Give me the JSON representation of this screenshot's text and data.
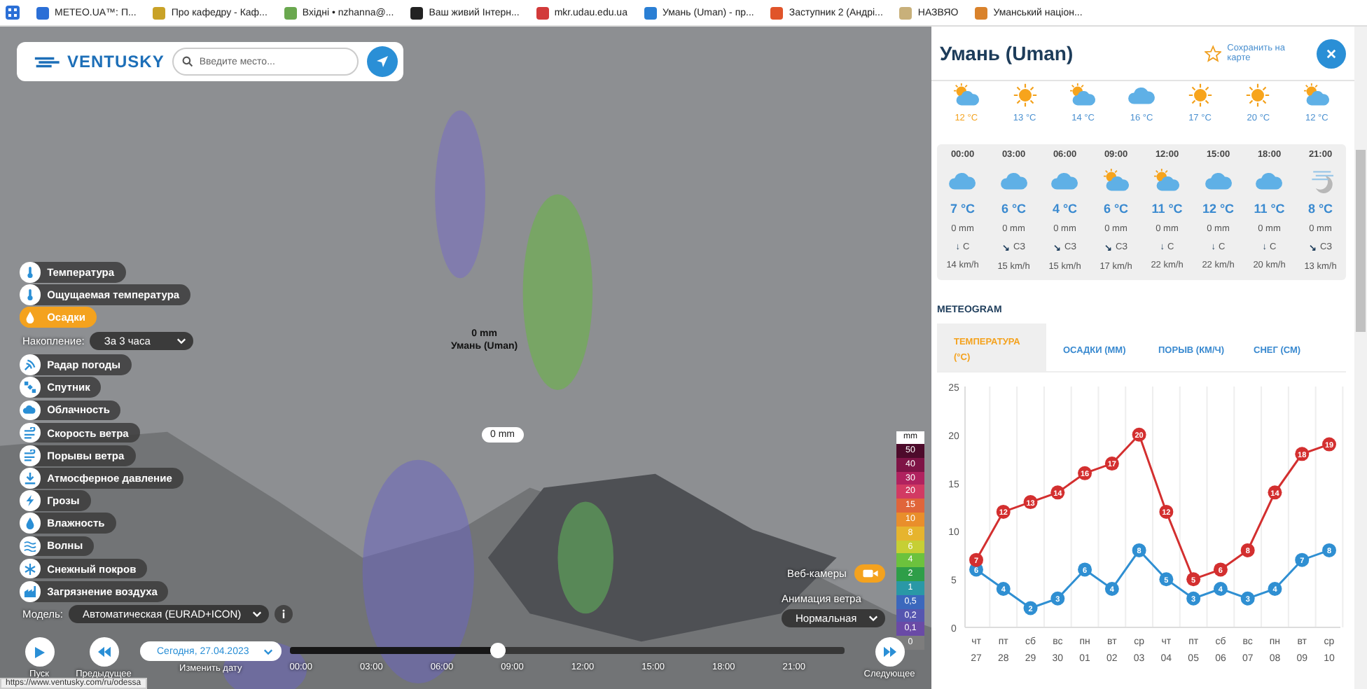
{
  "bookmarks": [
    {
      "label": "METEO.UA™: П...",
      "color": "#2b6fd6"
    },
    {
      "label": "Про кафедру - Каф...",
      "color": "#c9a227"
    },
    {
      "label": "Вхідні • nzhanna@...",
      "color": "#6aa84f"
    },
    {
      "label": "Ваш живий Інтерн...",
      "color": "#222222"
    },
    {
      "label": "mkr.udau.edu.ua",
      "color": "#d23a3a"
    },
    {
      "label": "Умань (Uman) - пр...",
      "color": "#2a7fd4"
    },
    {
      "label": "Заступник 2 (Андрі...",
      "color": "#e0542a"
    },
    {
      "label": "НАЗВЯО",
      "color": "#c8b07a"
    },
    {
      "label": "Уманський націон...",
      "color": "#d9822b"
    }
  ],
  "header": {
    "logo": "VENTUSKY",
    "search": {
      "placeholder": "Введите место..."
    }
  },
  "markers": [
    {
      "kind": "label",
      "reading": "0 mm",
      "place": "Умань (Uman)"
    },
    {
      "kind": "bubble",
      "reading": "0 mm"
    }
  ],
  "layers": [
    {
      "label": "Температура",
      "kind": "thermometer",
      "selected": false
    },
    {
      "label": "Ощущаемая температура",
      "kind": "thermometer",
      "selected": false
    },
    {
      "label": "Осадки",
      "kind": "droplet",
      "selected": true
    },
    {
      "label": "Радар погоды",
      "kind": "radar",
      "selected": false
    },
    {
      "label": "Спутник",
      "kind": "satellite",
      "selected": false
    },
    {
      "label": "Облачность",
      "kind": "cloud",
      "selected": false
    },
    {
      "label": "Скорость ветра",
      "kind": "wind",
      "selected": false
    },
    {
      "label": "Порывы ветра",
      "kind": "wind",
      "selected": false
    },
    {
      "label": "Атмосферное давление",
      "kind": "pressure",
      "selected": false
    },
    {
      "label": "Грозы",
      "kind": "bolt",
      "selected": false
    },
    {
      "label": "Влажность",
      "kind": "droplet",
      "selected": false
    },
    {
      "label": "Волны",
      "kind": "waves",
      "selected": false
    },
    {
      "label": "Снежный покров",
      "kind": "snowflake",
      "selected": false
    },
    {
      "label": "Загрязнение воздуха",
      "kind": "factory",
      "selected": false
    }
  ],
  "accumulation": {
    "label": "Накопление:",
    "value": "За 3 часа"
  },
  "model": {
    "label": "Модель:",
    "value": "Автоматическая (EURAD+ICON)"
  },
  "legend": {
    "unit": "mm",
    "steps": [
      {
        "label": "50",
        "color": "#4d0b2b"
      },
      {
        "label": "40",
        "color": "#7e1446"
      },
      {
        "label": "30",
        "color": "#b0225f"
      },
      {
        "label": "20",
        "color": "#d23a63"
      },
      {
        "label": "15",
        "color": "#e0653a"
      },
      {
        "label": "10",
        "color": "#e98e2b"
      },
      {
        "label": "8",
        "color": "#e6b42e"
      },
      {
        "label": "6",
        "color": "#c6cf34"
      },
      {
        "label": "4",
        "color": "#6cc23d"
      },
      {
        "label": "2",
        "color": "#2e9e48"
      },
      {
        "label": "1",
        "color": "#2a98a6"
      },
      {
        "label": "0,5",
        "color": "#3b68bd"
      },
      {
        "label": "0,2",
        "color": "#5656b0"
      },
      {
        "label": "0,1",
        "color": "#6a4aa6"
      },
      {
        "label": "0",
        "color": "#7d7d7d"
      }
    ]
  },
  "webcams": {
    "label": "Веб-камеры",
    "on": true
  },
  "wind_animation": {
    "label": "Анимация ветра",
    "value": "Нормальная"
  },
  "timeline": {
    "play": "Пуск",
    "previous": "Предыдущее",
    "date": "Сегодня, 27.04.2023",
    "change_date": "Изменить дату",
    "next": "Следующее",
    "times": [
      "00:00",
      "03:00",
      "06:00",
      "09:00",
      "12:00",
      "15:00",
      "18:00",
      "21:00"
    ],
    "level": 0.375
  },
  "status_url": "https://www.ventusky.com/ru/odessa",
  "panel": {
    "title": "Умань (Uman)",
    "save": "Сохранить на карте",
    "top_row": [
      {
        "kind": "sun-cloud",
        "temp": "12 °C",
        "selected": true
      },
      {
        "kind": "sun",
        "temp": "13 °C",
        "selected": false
      },
      {
        "kind": "sun-cloud",
        "temp": "14 °C",
        "selected": false
      },
      {
        "kind": "cloud",
        "temp": "16 °C",
        "selected": false
      },
      {
        "kind": "sun",
        "temp": "17 °C",
        "selected": false
      },
      {
        "kind": "sun",
        "temp": "20 °C",
        "selected": false
      },
      {
        "kind": "sun-cloud",
        "temp": "12 °C",
        "selected": false
      }
    ],
    "hours": [
      {
        "time": "00:00",
        "kind": "cloud",
        "temp": "7 °C",
        "precip": "0 mm",
        "arrow": "↓",
        "dir": "С",
        "wind": "14 km/h"
      },
      {
        "time": "03:00",
        "kind": "cloud",
        "temp": "6 °C",
        "precip": "0 mm",
        "arrow": "↘",
        "dir": "СЗ",
        "wind": "15 km/h"
      },
      {
        "time": "06:00",
        "kind": "cloud",
        "temp": "4 °C",
        "precip": "0 mm",
        "arrow": "↘",
        "dir": "СЗ",
        "wind": "15 km/h"
      },
      {
        "time": "09:00",
        "kind": "sun-cloud",
        "temp": "6 °C",
        "precip": "0 mm",
        "arrow": "↘",
        "dir": "СЗ",
        "wind": "17 km/h"
      },
      {
        "time": "12:00",
        "kind": "sun-cloud",
        "temp": "11 °C",
        "precip": "0 mm",
        "arrow": "↓",
        "dir": "С",
        "wind": "22 km/h"
      },
      {
        "time": "15:00",
        "kind": "cloud",
        "temp": "12 °C",
        "precip": "0 mm",
        "arrow": "↓",
        "dir": "С",
        "wind": "22 km/h"
      },
      {
        "time": "18:00",
        "kind": "cloud",
        "temp": "11 °C",
        "precip": "0 mm",
        "arrow": "↓",
        "dir": "С",
        "wind": "20 km/h"
      },
      {
        "time": "21:00",
        "kind": "moon-fog",
        "temp": "8 °C",
        "precip": "0 mm",
        "arrow": "↘",
        "dir": "СЗ",
        "wind": "13 km/h"
      }
    ],
    "meteogram": {
      "title": "METEOGRAM",
      "tabs": [
        {
          "label": "ТЕМПЕРАТУРА (°C)",
          "selected": true
        },
        {
          "label": "ОСАДКИ (ММ)",
          "selected": false
        },
        {
          "label": "ПОРЫВ (КМ/Ч)",
          "selected": false
        },
        {
          "label": "СНЕГ (СМ)",
          "selected": false
        }
      ],
      "chart_data": {
        "type": "line",
        "categories": [
          "чт 27",
          "пт 28",
          "сб 29",
          "вс 30",
          "пн 01",
          "вт 02",
          "ср 03",
          "чт 04",
          "пт 05",
          "сб 06",
          "вс 07",
          "пн 08",
          "вт 09",
          "ср 10"
        ],
        "series": [
          {
            "color": "#2f8fd2",
            "marker": "circle",
            "values": [
              6,
              4,
              2,
              3,
              6,
              4,
              8,
              5,
              3,
              4,
              3,
              4,
              7,
              8
            ]
          },
          {
            "color": "#d32f2f",
            "marker": "circle",
            "values": [
              7,
              12,
              13,
              14,
              16,
              17,
              20,
              12,
              5,
              6,
              8,
              14,
              18,
              19
            ]
          }
        ],
        "data_labels": true,
        "ylim": [
          0,
          25
        ],
        "yticks": [
          0,
          5,
          10,
          15,
          20,
          25
        ]
      }
    }
  }
}
